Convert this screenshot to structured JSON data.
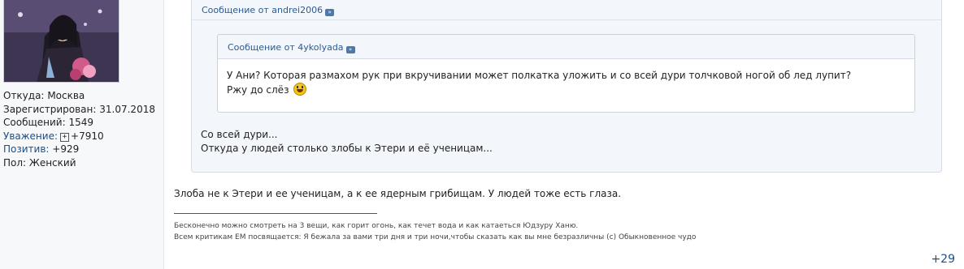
{
  "author": {
    "location_label": "Откуда:",
    "location": "Москва",
    "registered_label": "Зарегистрирован:",
    "registered": "31.07.2018",
    "messages_label": "Сообщений:",
    "messages": "1549",
    "respect_label": "Уважение:",
    "respect": "+7910",
    "positive_label": "Позитив:",
    "positive": "+929",
    "gender_label": "Пол:",
    "gender": "Женский"
  },
  "quote_outer": {
    "header": "Сообщение от andrei2006",
    "line1": "Со всей дури...",
    "line2": "Откуда у людей столько злобы к Этери и её ученицам..."
  },
  "quote_inner": {
    "header": "Сообщение от 4ykolyada",
    "line1": "У Ани? Которая размахом рук при вкручивании может полкатка уложить и со всей дури толчковой ногой об лед лупит?",
    "line2": "Ржу до слёз"
  },
  "post": {
    "text": "Злоба не к Этери и ее ученицам, а к ее ядерным грибищам. У людей тоже есть глаза."
  },
  "signature": {
    "line1": "Бесконечно можно смотреть на 3 вещи, как горит огонь, как течет вода и как катаеться Юдзуру Ханю.",
    "line2": "Всем критикам ЕМ посвящается: Я бежала за вами три дня и три ночи,чтобы сказать как вы мне безразличны (с) Обыкновенное чудо"
  },
  "rating": "+29",
  "icons": {
    "quote_link": "view-post-arrow-icon",
    "respect": "plus-box-icon",
    "smiley": "laughing-smiley-icon"
  }
}
